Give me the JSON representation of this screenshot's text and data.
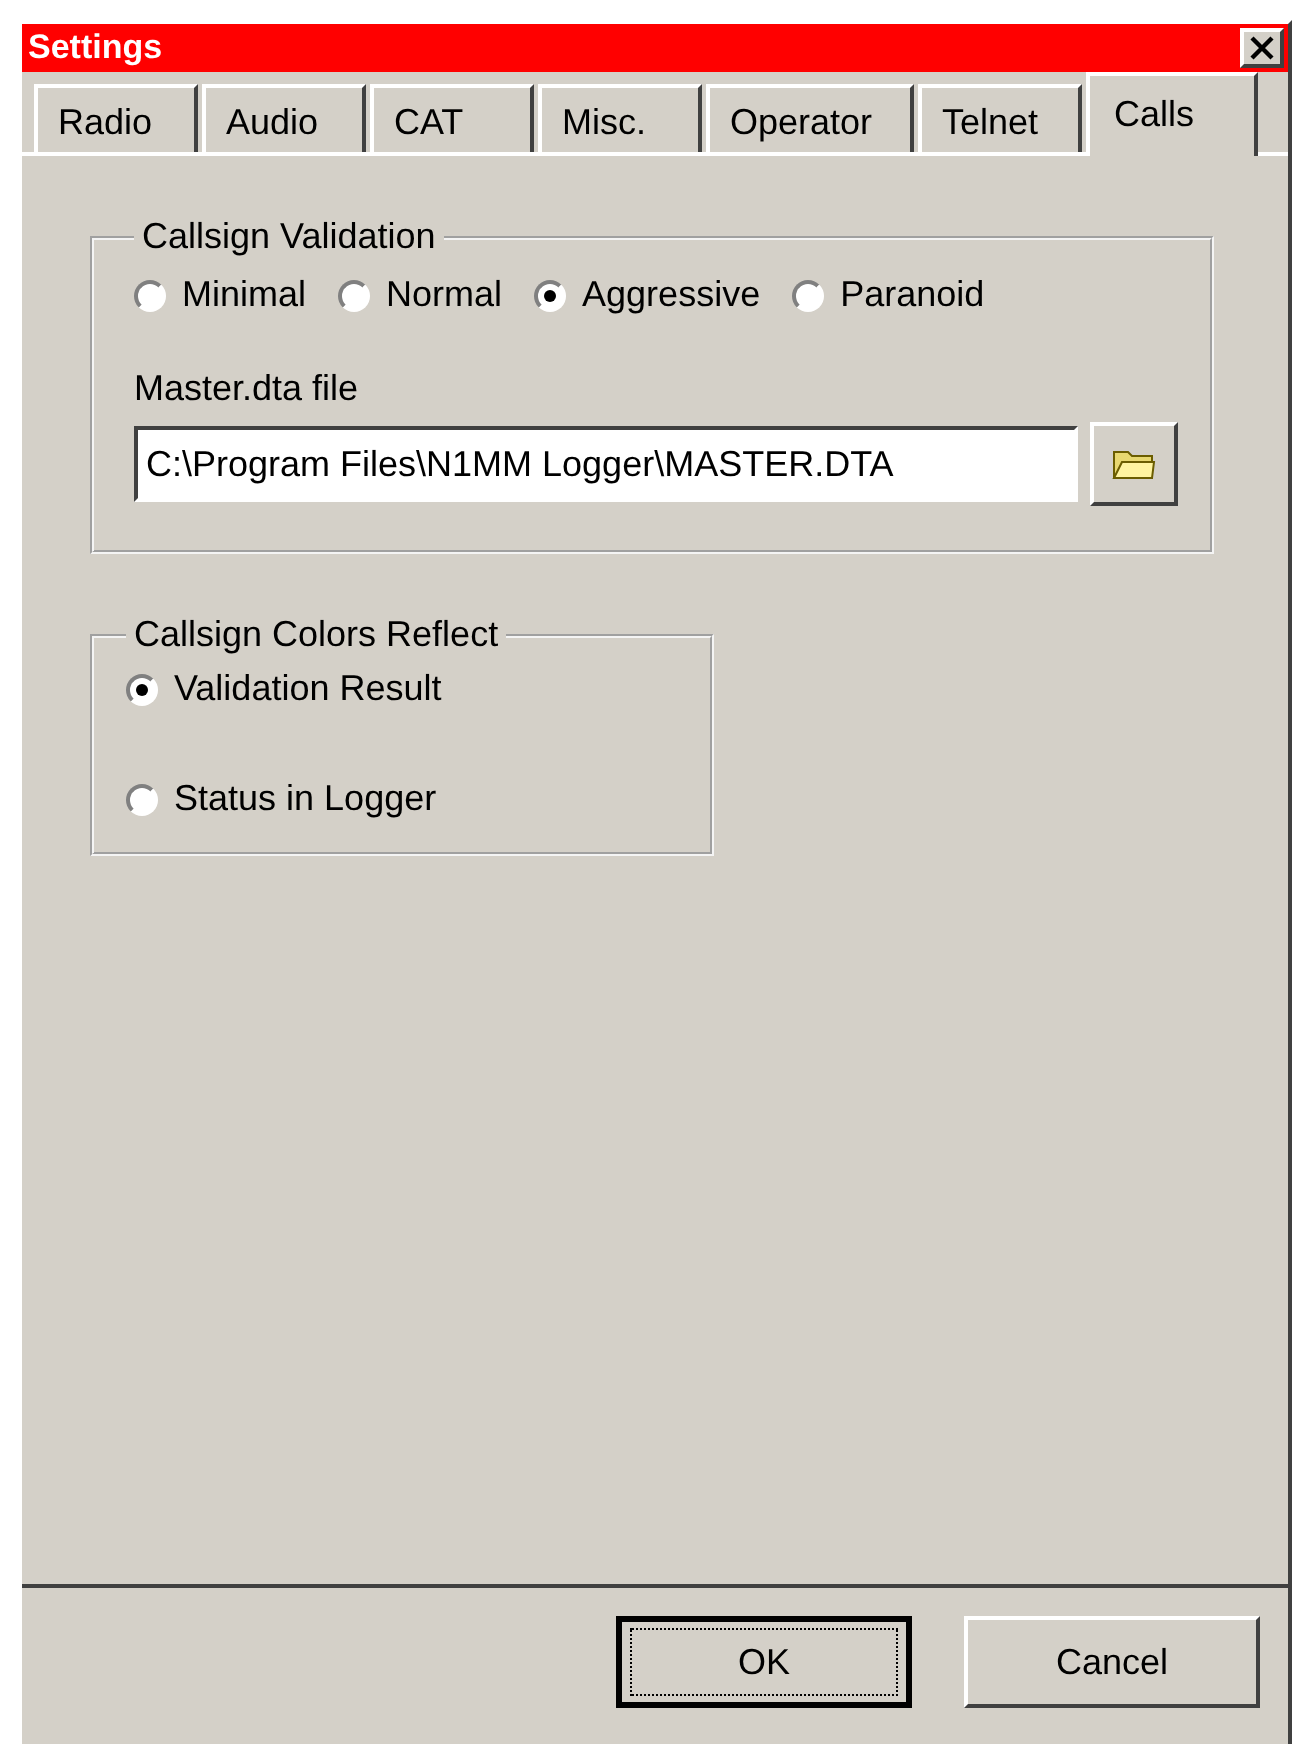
{
  "window": {
    "title": "Settings"
  },
  "tabs": [
    {
      "label": "Radio",
      "selected": false
    },
    {
      "label": "Audio",
      "selected": false
    },
    {
      "label": "CAT",
      "selected": false
    },
    {
      "label": "Misc.",
      "selected": false
    },
    {
      "label": "Operator",
      "selected": false
    },
    {
      "label": "Telnet",
      "selected": false
    },
    {
      "label": "Calls",
      "selected": true
    }
  ],
  "validation": {
    "title": "Callsign Validation",
    "options": [
      {
        "label": "Minimal",
        "selected": false
      },
      {
        "label": "Normal",
        "selected": false
      },
      {
        "label": "Aggressive",
        "selected": true
      },
      {
        "label": "Paranoid",
        "selected": false
      }
    ],
    "file_label": "Master.dta file",
    "file_value": "C:\\Program Files\\N1MM Logger\\MASTER.DTA"
  },
  "colors": {
    "title": "Callsign Colors Reflect",
    "options": [
      {
        "label": "Validation Result",
        "selected": true
      },
      {
        "label": "Status in Logger",
        "selected": false
      }
    ]
  },
  "buttons": [
    {
      "label": "OK",
      "default": true
    },
    {
      "label": "Cancel",
      "default": false
    }
  ]
}
